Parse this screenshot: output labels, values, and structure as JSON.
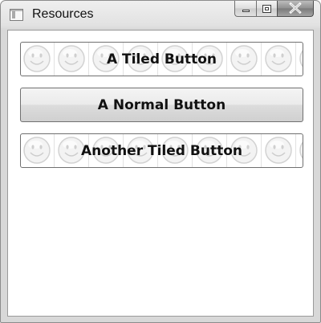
{
  "window": {
    "title": "Resources"
  },
  "caption_buttons": {
    "minimize": "minimize-icon",
    "maximize": "maximize-icon",
    "close": "close-icon"
  },
  "buttons": [
    {
      "label": "A Tiled Button",
      "style": "tiled",
      "tile_icon": "smiley-face-icon"
    },
    {
      "label": "A Normal Button",
      "style": "normal"
    },
    {
      "label": "Another Tiled Button",
      "style": "tiled",
      "tile_icon": "smiley-face-icon"
    }
  ]
}
